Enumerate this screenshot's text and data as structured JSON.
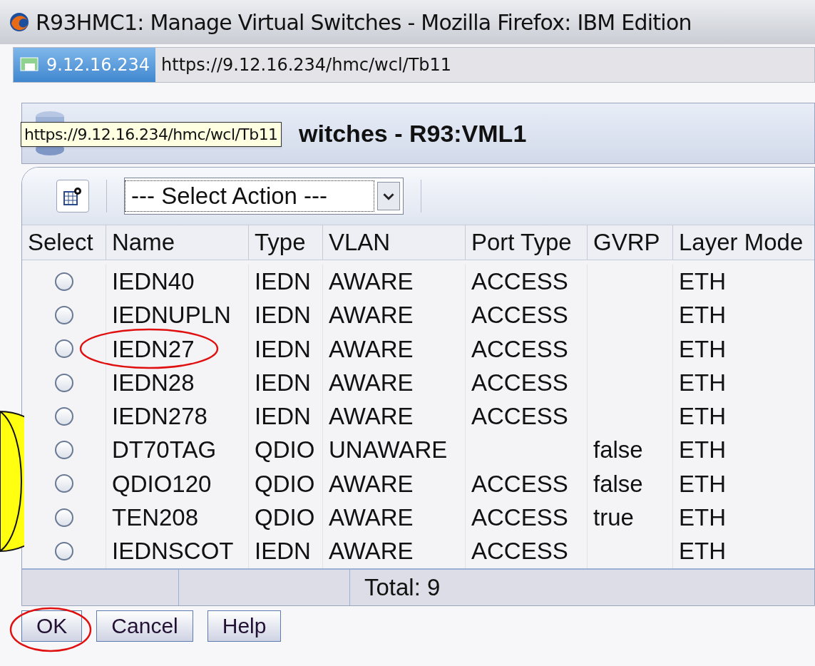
{
  "window": {
    "title": "R93HMC1: Manage Virtual Switches - Mozilla Firefox: IBM Edition"
  },
  "address_bar": {
    "site": "9.12.16.234",
    "url": "https://9.12.16.234/hmc/wcl/Tb11"
  },
  "tooltip": "https://9.12.16.234/hmc/wcl/Tb11",
  "panel": {
    "title": "witches - R93:VML1"
  },
  "toolbar": {
    "action_select": "--- Select Action ---"
  },
  "table": {
    "select_column": "Select",
    "columns": [
      "Name",
      "Type",
      "VLAN",
      "Port Type",
      "GVRP",
      "Layer Mode"
    ],
    "rows": [
      {
        "selected": false,
        "circled": false,
        "cells": [
          "IEDN40",
          "IEDN",
          "AWARE",
          "ACCESS",
          "",
          "ETH"
        ]
      },
      {
        "selected": false,
        "circled": false,
        "cells": [
          "IEDNUPLN",
          "IEDN",
          "AWARE",
          "ACCESS",
          "",
          "ETH"
        ]
      },
      {
        "selected": false,
        "circled": true,
        "cells": [
          "IEDN27",
          "IEDN",
          "AWARE",
          "ACCESS",
          "",
          "ETH"
        ]
      },
      {
        "selected": false,
        "circled": false,
        "cells": [
          "IEDN28",
          "IEDN",
          "AWARE",
          "ACCESS",
          "",
          "ETH"
        ]
      },
      {
        "selected": false,
        "circled": false,
        "cells": [
          "IEDN278",
          "IEDN",
          "AWARE",
          "ACCESS",
          "",
          "ETH"
        ]
      },
      {
        "selected": false,
        "circled": false,
        "cells": [
          "DT70TAG",
          "QDIO",
          "UNAWARE",
          "",
          "false",
          "ETH"
        ]
      },
      {
        "selected": false,
        "circled": false,
        "cells": [
          "QDIO120",
          "QDIO",
          "AWARE",
          "ACCESS",
          "false",
          "ETH"
        ]
      },
      {
        "selected": false,
        "circled": false,
        "cells": [
          "TEN208",
          "QDIO",
          "AWARE",
          "ACCESS",
          "true",
          "ETH"
        ]
      },
      {
        "selected": false,
        "circled": false,
        "cells": [
          "IEDNSCOT",
          "IEDN",
          "AWARE",
          "ACCESS",
          "",
          "ETH"
        ]
      }
    ],
    "total": "Total: 9"
  },
  "buttons": [
    {
      "label": "OK",
      "circled": true
    },
    {
      "label": "Cancel",
      "circled": false
    },
    {
      "label": "Help",
      "circled": false
    }
  ],
  "side_marker": true
}
